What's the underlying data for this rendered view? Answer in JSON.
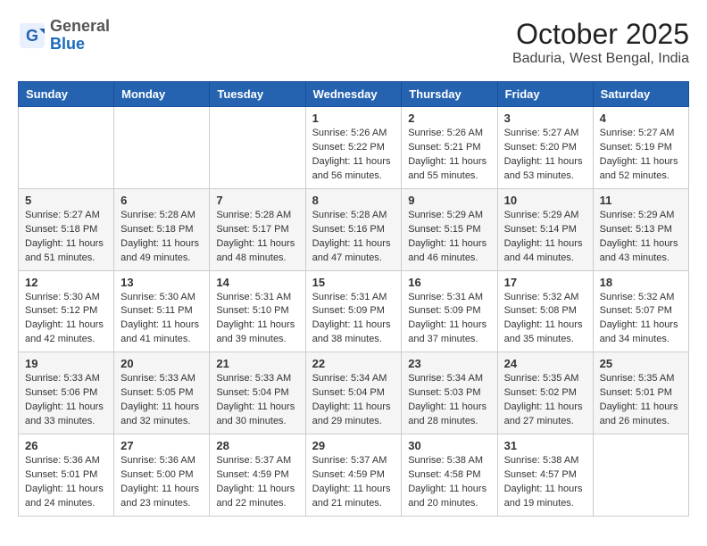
{
  "header": {
    "logo_general": "General",
    "logo_blue": "Blue",
    "month_title": "October 2025",
    "location": "Baduria, West Bengal, India"
  },
  "days_of_week": [
    "Sunday",
    "Monday",
    "Tuesday",
    "Wednesday",
    "Thursday",
    "Friday",
    "Saturday"
  ],
  "weeks": [
    [
      {
        "day": "",
        "info": ""
      },
      {
        "day": "",
        "info": ""
      },
      {
        "day": "",
        "info": ""
      },
      {
        "day": "1",
        "info": "Sunrise: 5:26 AM\nSunset: 5:22 PM\nDaylight: 11 hours and 56 minutes."
      },
      {
        "day": "2",
        "info": "Sunrise: 5:26 AM\nSunset: 5:21 PM\nDaylight: 11 hours and 55 minutes."
      },
      {
        "day": "3",
        "info": "Sunrise: 5:27 AM\nSunset: 5:20 PM\nDaylight: 11 hours and 53 minutes."
      },
      {
        "day": "4",
        "info": "Sunrise: 5:27 AM\nSunset: 5:19 PM\nDaylight: 11 hours and 52 minutes."
      }
    ],
    [
      {
        "day": "5",
        "info": "Sunrise: 5:27 AM\nSunset: 5:18 PM\nDaylight: 11 hours and 51 minutes."
      },
      {
        "day": "6",
        "info": "Sunrise: 5:28 AM\nSunset: 5:18 PM\nDaylight: 11 hours and 49 minutes."
      },
      {
        "day": "7",
        "info": "Sunrise: 5:28 AM\nSunset: 5:17 PM\nDaylight: 11 hours and 48 minutes."
      },
      {
        "day": "8",
        "info": "Sunrise: 5:28 AM\nSunset: 5:16 PM\nDaylight: 11 hours and 47 minutes."
      },
      {
        "day": "9",
        "info": "Sunrise: 5:29 AM\nSunset: 5:15 PM\nDaylight: 11 hours and 46 minutes."
      },
      {
        "day": "10",
        "info": "Sunrise: 5:29 AM\nSunset: 5:14 PM\nDaylight: 11 hours and 44 minutes."
      },
      {
        "day": "11",
        "info": "Sunrise: 5:29 AM\nSunset: 5:13 PM\nDaylight: 11 hours and 43 minutes."
      }
    ],
    [
      {
        "day": "12",
        "info": "Sunrise: 5:30 AM\nSunset: 5:12 PM\nDaylight: 11 hours and 42 minutes."
      },
      {
        "day": "13",
        "info": "Sunrise: 5:30 AM\nSunset: 5:11 PM\nDaylight: 11 hours and 41 minutes."
      },
      {
        "day": "14",
        "info": "Sunrise: 5:31 AM\nSunset: 5:10 PM\nDaylight: 11 hours and 39 minutes."
      },
      {
        "day": "15",
        "info": "Sunrise: 5:31 AM\nSunset: 5:09 PM\nDaylight: 11 hours and 38 minutes."
      },
      {
        "day": "16",
        "info": "Sunrise: 5:31 AM\nSunset: 5:09 PM\nDaylight: 11 hours and 37 minutes."
      },
      {
        "day": "17",
        "info": "Sunrise: 5:32 AM\nSunset: 5:08 PM\nDaylight: 11 hours and 35 minutes."
      },
      {
        "day": "18",
        "info": "Sunrise: 5:32 AM\nSunset: 5:07 PM\nDaylight: 11 hours and 34 minutes."
      }
    ],
    [
      {
        "day": "19",
        "info": "Sunrise: 5:33 AM\nSunset: 5:06 PM\nDaylight: 11 hours and 33 minutes."
      },
      {
        "day": "20",
        "info": "Sunrise: 5:33 AM\nSunset: 5:05 PM\nDaylight: 11 hours and 32 minutes."
      },
      {
        "day": "21",
        "info": "Sunrise: 5:33 AM\nSunset: 5:04 PM\nDaylight: 11 hours and 30 minutes."
      },
      {
        "day": "22",
        "info": "Sunrise: 5:34 AM\nSunset: 5:04 PM\nDaylight: 11 hours and 29 minutes."
      },
      {
        "day": "23",
        "info": "Sunrise: 5:34 AM\nSunset: 5:03 PM\nDaylight: 11 hours and 28 minutes."
      },
      {
        "day": "24",
        "info": "Sunrise: 5:35 AM\nSunset: 5:02 PM\nDaylight: 11 hours and 27 minutes."
      },
      {
        "day": "25",
        "info": "Sunrise: 5:35 AM\nSunset: 5:01 PM\nDaylight: 11 hours and 26 minutes."
      }
    ],
    [
      {
        "day": "26",
        "info": "Sunrise: 5:36 AM\nSunset: 5:01 PM\nDaylight: 11 hours and 24 minutes."
      },
      {
        "day": "27",
        "info": "Sunrise: 5:36 AM\nSunset: 5:00 PM\nDaylight: 11 hours and 23 minutes."
      },
      {
        "day": "28",
        "info": "Sunrise: 5:37 AM\nSunset: 4:59 PM\nDaylight: 11 hours and 22 minutes."
      },
      {
        "day": "29",
        "info": "Sunrise: 5:37 AM\nSunset: 4:59 PM\nDaylight: 11 hours and 21 minutes."
      },
      {
        "day": "30",
        "info": "Sunrise: 5:38 AM\nSunset: 4:58 PM\nDaylight: 11 hours and 20 minutes."
      },
      {
        "day": "31",
        "info": "Sunrise: 5:38 AM\nSunset: 4:57 PM\nDaylight: 11 hours and 19 minutes."
      },
      {
        "day": "",
        "info": ""
      }
    ]
  ]
}
